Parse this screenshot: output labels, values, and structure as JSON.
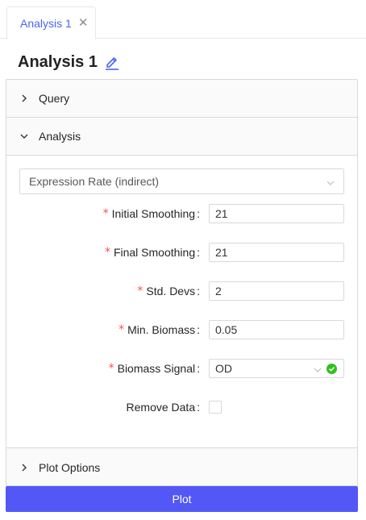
{
  "tabs": [
    {
      "label": "Analysis 1",
      "active": true
    }
  ],
  "page": {
    "title": "Analysis 1"
  },
  "panels": {
    "query": {
      "label": "Query",
      "expanded": false
    },
    "analysis": {
      "label": "Analysis",
      "expanded": true
    },
    "plot_options": {
      "label": "Plot Options",
      "expanded": false
    }
  },
  "analysis": {
    "method_select": "Expression Rate (indirect)",
    "fields": {
      "initial_smoothing": {
        "label": "Initial Smoothing",
        "value": "21",
        "required": true
      },
      "final_smoothing": {
        "label": "Final Smoothing",
        "value": "21",
        "required": true
      },
      "std_devs": {
        "label": "Std. Devs",
        "value": "2",
        "required": true
      },
      "min_biomass": {
        "label": "Min. Biomass",
        "value": "0.05",
        "required": true
      },
      "biomass_signal": {
        "label": "Biomass Signal",
        "value": "OD",
        "required": true
      },
      "remove_data": {
        "label": "Remove Data",
        "checked": false,
        "required": false
      }
    },
    "required_mark": "*",
    "colon": ":"
  },
  "actions": {
    "plot_label": "Plot"
  },
  "colors": {
    "accent": "#4b63f1",
    "primary_button": "#5257f6",
    "required": "#ff4d4f",
    "valid": "#2fc01e"
  },
  "icons": {
    "tab_close": "close-icon",
    "title_edit": "edit-icon",
    "collapsed": "chevron-right-icon",
    "expanded": "chevron-down-icon",
    "valid": "check-circle-icon"
  }
}
